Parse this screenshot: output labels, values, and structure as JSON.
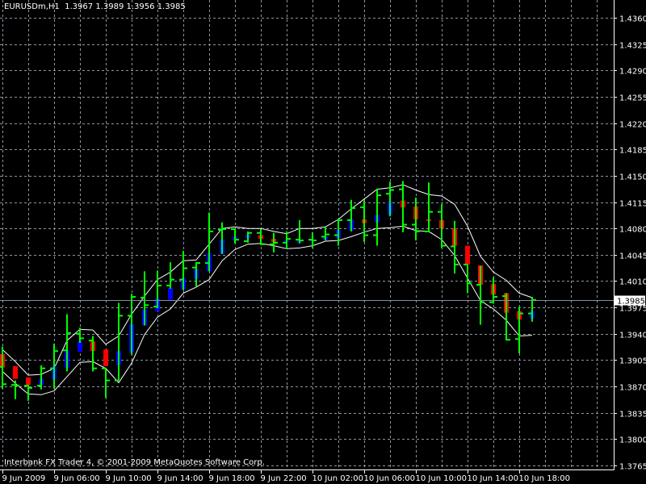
{
  "header": {
    "symbol": "EURUSDm,H1",
    "open": "1.3967",
    "high": "1.3989",
    "low": "1.3956",
    "close": "1.3985"
  },
  "footer": {
    "copyright": "Interbank FX Trader 4, © 2001-2009 MetaQuotes Software Corp."
  },
  "colors": {
    "background": "#000000",
    "bar": "#00ff00",
    "bull_body": "#0000ff",
    "bear_body": "#ff0000",
    "band": "#ffffff",
    "grid": "#8a96a3",
    "price_line": "#8090a8"
  },
  "chart_data": {
    "type": "ohlc",
    "timeframe": "H1",
    "current_price": "1.3985",
    "ylim": [
      1.3765,
      1.436
    ],
    "y_ticks": [
      "1.4360",
      "1.4325",
      "1.4290",
      "1.4255",
      "1.4220",
      "1.4185",
      "1.4150",
      "1.4115",
      "1.4080",
      "1.4045",
      "1.4010",
      "1.3975",
      "1.3940",
      "1.3905",
      "1.3870",
      "1.3835",
      "1.3800",
      "1.3765"
    ],
    "x_labels": [
      "9 Jun 2009",
      "9 Jun 06:00",
      "9 Jun 10:00",
      "9 Jun 14:00",
      "9 Jun 18:00",
      "9 Jun 22:00",
      "10 Jun 02:00",
      "10 Jun 06:00",
      "10 Jun 10:00",
      "10 Jun 14:00",
      "10 Jun 18:00"
    ],
    "bars_per_label": 4,
    "grid": true,
    "ohlc": [
      [
        1.3896,
        1.3923,
        1.3867,
        1.3873
      ],
      [
        1.3872,
        1.3878,
        1.3853,
        1.3871
      ],
      [
        1.3871,
        1.3872,
        1.3851,
        1.3868
      ],
      [
        1.3871,
        1.3898,
        1.3866,
        1.3894
      ],
      [
        1.3894,
        1.3927,
        1.3867,
        1.3917
      ],
      [
        1.3918,
        1.3966,
        1.389,
        1.3941
      ],
      [
        1.394,
        1.3948,
        1.3928,
        1.3934
      ],
      [
        1.3931,
        1.3937,
        1.389,
        1.3894
      ],
      [
        1.3894,
        1.3894,
        1.3855,
        1.3878
      ],
      [
        1.3878,
        1.3981,
        1.3878,
        1.3964
      ],
      [
        1.3964,
        1.3993,
        1.3912,
        1.3989
      ],
      [
        1.3988,
        1.4023,
        1.3951,
        1.3978
      ],
      [
        1.3976,
        1.4024,
        1.3974,
        1.4004
      ],
      [
        1.4004,
        1.4035,
        1.4,
        1.4012
      ],
      [
        1.4012,
        1.405,
        1.3998,
        1.4027
      ],
      [
        1.4028,
        1.4035,
        1.4003,
        1.4034
      ],
      [
        1.4034,
        1.4101,
        1.4023,
        1.4076
      ],
      [
        1.4078,
        1.4088,
        1.4046,
        1.4079
      ],
      [
        1.4079,
        1.408,
        1.406,
        1.4065
      ],
      [
        1.4063,
        1.4076,
        1.4061,
        1.4074
      ],
      [
        1.4074,
        1.4079,
        1.4058,
        1.4059
      ],
      [
        1.4059,
        1.4074,
        1.4048,
        1.4061
      ],
      [
        1.4061,
        1.4076,
        1.4053,
        1.4066
      ],
      [
        1.4065,
        1.4091,
        1.406,
        1.4064
      ],
      [
        1.4065,
        1.4075,
        1.4054,
        1.4064
      ],
      [
        1.4069,
        1.4082,
        1.4064,
        1.4072
      ],
      [
        1.4071,
        1.4093,
        1.4057,
        1.4091
      ],
      [
        1.4091,
        1.4118,
        1.4076,
        1.4107
      ],
      [
        1.4108,
        1.4117,
        1.4062,
        1.4071
      ],
      [
        1.4071,
        1.4133,
        1.4057,
        1.4124
      ],
      [
        1.4126,
        1.4142,
        1.4096,
        1.4131
      ],
      [
        1.4132,
        1.4143,
        1.4075,
        1.4085
      ],
      [
        1.4085,
        1.4121,
        1.4064,
        1.4076
      ],
      [
        1.4076,
        1.4141,
        1.4075,
        1.4102
      ],
      [
        1.4102,
        1.4112,
        1.4054,
        1.4057
      ],
      [
        1.4056,
        1.409,
        1.402,
        1.4032
      ],
      [
        1.4032,
        1.4032,
        1.3994,
        1.4007
      ],
      [
        1.4005,
        1.403,
        1.3952,
        1.3982
      ],
      [
        1.3982,
        1.4015,
        1.398,
        1.3989
      ],
      [
        1.399,
        1.3994,
        1.3931,
        1.3932
      ],
      [
        1.3933,
        1.3976,
        1.3914,
        1.3967
      ],
      [
        1.3967,
        1.3989,
        1.3956,
        1.3985
      ]
    ],
    "ha_bodies": [
      [
        1.3913,
        1.3895
      ],
      [
        1.3897,
        1.388
      ],
      [
        1.3882,
        1.3872
      ],
      [
        1.3872,
        1.388
      ],
      [
        1.3879,
        1.3897
      ],
      [
        1.3895,
        1.3918
      ],
      [
        1.3916,
        1.393
      ],
      [
        1.393,
        1.3917
      ],
      [
        1.3919,
        1.3897
      ],
      [
        1.3898,
        1.3917
      ],
      [
        1.3915,
        1.3953
      ],
      [
        1.3951,
        1.3972
      ],
      [
        1.397,
        1.3987
      ],
      [
        1.3985,
        1.4001
      ],
      [
        1.3999,
        1.4014
      ],
      [
        1.4013,
        1.4026
      ],
      [
        1.4023,
        1.4047
      ],
      [
        1.4046,
        1.4065
      ],
      [
        1.4064,
        1.4069
      ],
      [
        1.4067,
        1.4072
      ],
      [
        1.4071,
        1.4066
      ],
      [
        1.4066,
        1.4062
      ],
      [
        1.4062,
        1.4064
      ],
      [
        1.4061,
        1.4065
      ],
      [
        1.4063,
        1.4065
      ],
      [
        1.4065,
        1.4069
      ],
      [
        1.4067,
        1.4078
      ],
      [
        1.4077,
        1.4092
      ],
      [
        1.4092,
        1.4087
      ],
      [
        1.4088,
        1.4098
      ],
      [
        1.4098,
        1.4116
      ],
      [
        1.4117,
        1.4108
      ],
      [
        1.4109,
        1.4092
      ],
      [
        1.4092,
        1.4091
      ],
      [
        1.4091,
        1.408
      ],
      [
        1.408,
        1.4057
      ],
      [
        1.4057,
        1.4032
      ],
      [
        1.4031,
        1.4005
      ],
      [
        1.4006,
        1.3992
      ],
      [
        1.3994,
        1.3968
      ],
      [
        1.397,
        1.3959
      ],
      [
        1.396,
        1.397
      ]
    ],
    "upper_band": [
      1.3919,
      1.3903,
      1.3885,
      1.3886,
      1.3894,
      1.3931,
      1.3946,
      1.3945,
      1.3926,
      1.3937,
      1.3966,
      1.399,
      1.4012,
      1.4022,
      1.4037,
      1.4038,
      1.4059,
      1.408,
      1.4082,
      1.408,
      1.408,
      1.4076,
      1.4073,
      1.408,
      1.408,
      1.4082,
      1.4092,
      1.4106,
      1.4119,
      1.4132,
      1.4134,
      1.4138,
      1.4131,
      1.4125,
      1.4123,
      1.4112,
      1.4083,
      1.4043,
      1.4022,
      1.4011,
      1.3994,
      1.3988
    ],
    "lower_band": [
      1.389,
      1.3874,
      1.386,
      1.3859,
      1.3864,
      1.3883,
      1.3902,
      1.3903,
      1.3894,
      1.3875,
      1.3901,
      1.3939,
      1.3962,
      1.3973,
      1.3994,
      1.4002,
      1.4012,
      1.4037,
      1.4052,
      1.4059,
      1.406,
      1.4057,
      1.4053,
      1.4054,
      1.4057,
      1.4063,
      1.4064,
      1.4069,
      1.4075,
      1.408,
      1.4081,
      1.4083,
      1.4077,
      1.4076,
      1.4065,
      1.4044,
      1.4014,
      1.3984,
      1.3973,
      1.3958,
      1.3937,
      1.3938
    ]
  }
}
